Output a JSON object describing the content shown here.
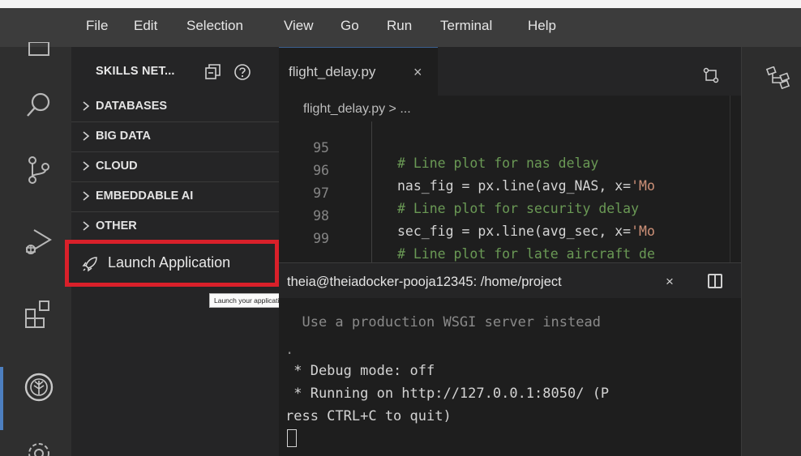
{
  "menubar": {
    "items": [
      "File",
      "Edit",
      "Selection",
      "View",
      "Go",
      "Run",
      "Terminal",
      "Help"
    ]
  },
  "activity_bar": {
    "icons": [
      "window-icon",
      "search-icon",
      "source-control-icon",
      "run-debug-icon",
      "extensions-icon",
      "skills-network-icon",
      "settings-gear-icon"
    ]
  },
  "sidebar": {
    "title": "SKILLS NET...",
    "sections": [
      {
        "label": "DATABASES",
        "collapsed": true
      },
      {
        "label": "BIG DATA",
        "collapsed": true
      },
      {
        "label": "CLOUD",
        "collapsed": true
      },
      {
        "label": "EMBEDDABLE AI",
        "collapsed": true
      },
      {
        "label": "OTHER",
        "collapsed": true
      }
    ],
    "launch": {
      "label": "Launch Application",
      "icon": "rocket-icon",
      "highlight_color": "#d9202a"
    },
    "tooltip": "Launch your application from a port"
  },
  "editor": {
    "tab": {
      "name": "flight_delay.py",
      "close": "×"
    },
    "breadcrumb": "flight_delay.py  >  ...",
    "lines": [
      {
        "number": "95",
        "indent": "",
        "comment": "# Line plot for nas delay",
        "code": "",
        "string": ""
      },
      {
        "number": "96",
        "indent": "",
        "comment": "",
        "code": "nas_fig = px.line(avg_NAS, x=",
        "string": "'Mo"
      },
      {
        "number": "97",
        "indent": "",
        "comment": "# Line plot for security delay",
        "code": "",
        "string": ""
      },
      {
        "number": "98",
        "indent": "",
        "comment": "",
        "code": "sec_fig = px.line(avg_sec, x=",
        "string": "'Mo"
      },
      {
        "number": "99",
        "indent": "",
        "comment": "# Line plot for late aircraft de",
        "code": "",
        "string": ""
      }
    ]
  },
  "terminal": {
    "title": "theia@theiadocker-pooja12345: /home/project",
    "close": "×",
    "lines": [
      {
        "text": "  Use a production WSGI server instead",
        "dim": true
      },
      {
        "text": ".",
        "dim": true
      },
      {
        "text": " * Debug mode: off",
        "dim": false
      },
      {
        "text": " * Running on http://127.0.0.1:8050/ (P",
        "dim": false
      },
      {
        "text": "ress CTRL+C to quit)",
        "dim": false
      }
    ]
  },
  "right_panel": {
    "icon": "outline-hierarchy-icon"
  }
}
